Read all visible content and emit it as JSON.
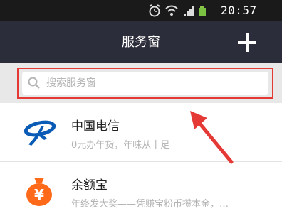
{
  "status_bar": {
    "time": "20:57"
  },
  "header": {
    "title": "服务窗",
    "add_icon": "plus-icon"
  },
  "search": {
    "placeholder": "搜索服务窗",
    "icon": "search-icon"
  },
  "services": [
    {
      "name": "中国电信",
      "desc": "0元办年货，年味从十足",
      "icon": "china-telecom-logo"
    },
    {
      "name": "余额宝",
      "desc": "年终发大奖——凭赚宝粉币攒本金，…",
      "icon": "yuebao-logo"
    }
  ],
  "colors": {
    "nav_bg": "#2c2d3a",
    "highlight": "#e53935",
    "telecom_blue": "#0a5bb5",
    "yuebao_orange": "#ff6a1a"
  }
}
